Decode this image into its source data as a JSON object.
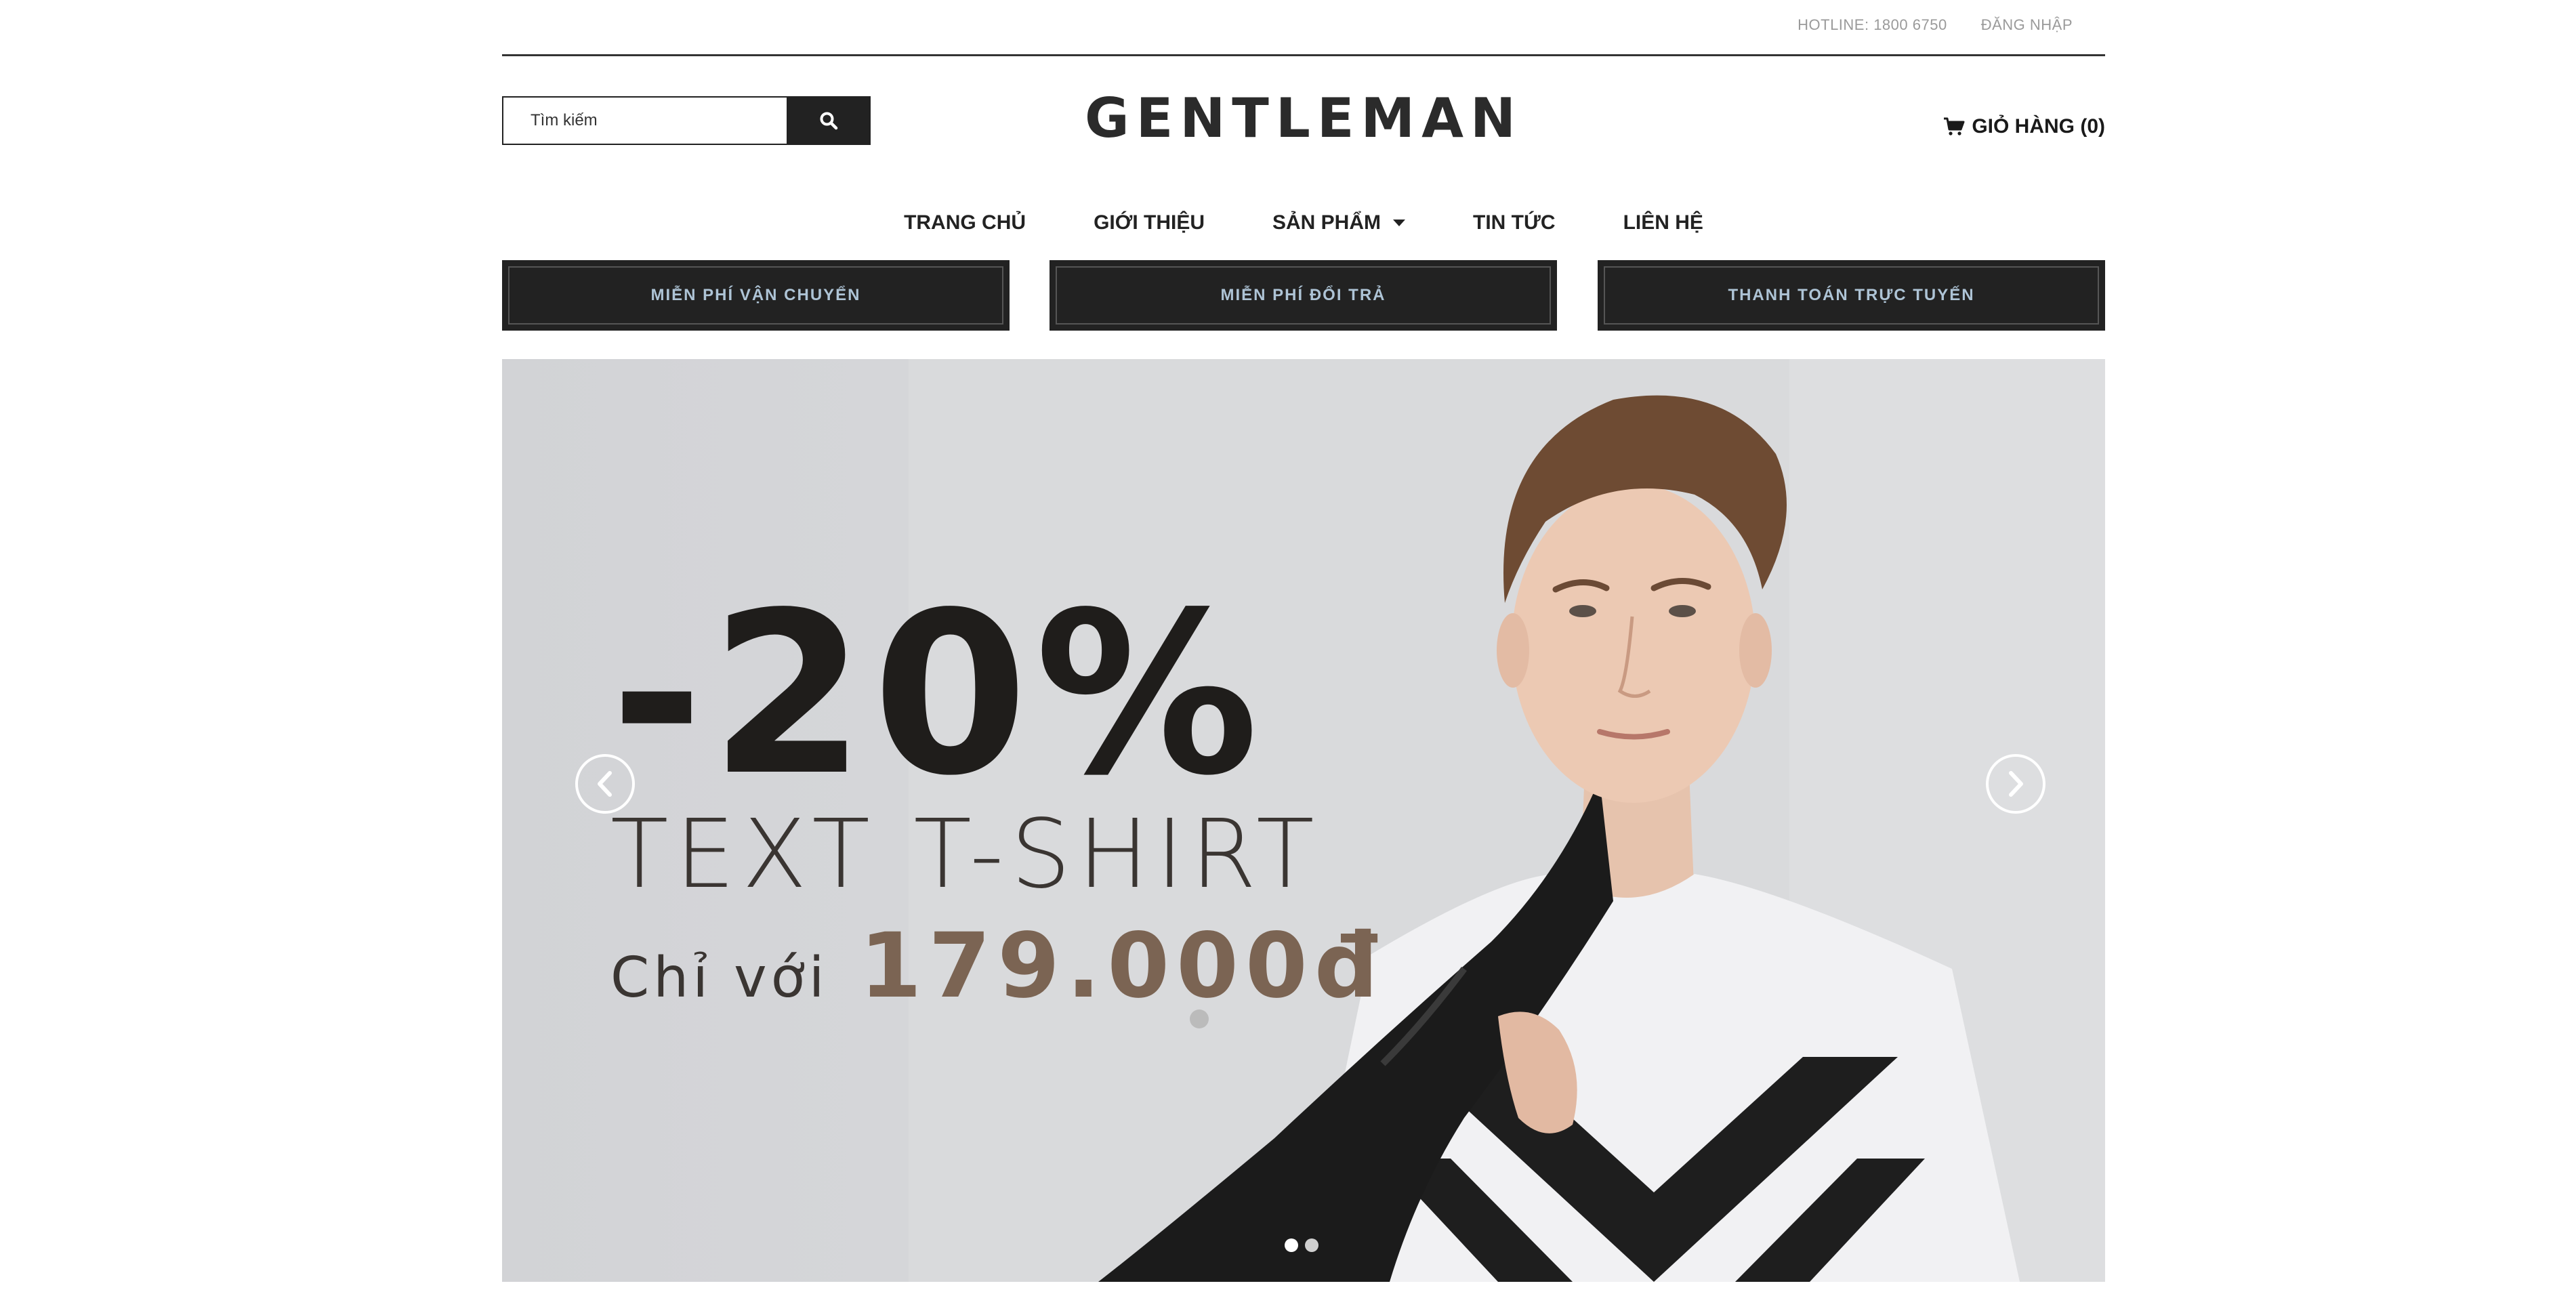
{
  "topbar": {
    "hotline": "HOTLINE: 1800 6750",
    "login": "ĐĂNG NHẬP"
  },
  "search": {
    "placeholder": "Tìm kiếm",
    "icon": "search-icon"
  },
  "logo": "GENTLEMAN",
  "cart": {
    "label": "GIỎ HÀNG (0)",
    "icon": "cart-icon"
  },
  "nav": {
    "items": [
      {
        "label": "TRANG CHỦ"
      },
      {
        "label": "GIỚI THIỆU"
      },
      {
        "label": "SẢN PHẨM"
      },
      {
        "label": "TIN TỨC"
      },
      {
        "label": "LIÊN HỆ"
      }
    ]
  },
  "features": [
    {
      "label": "MIỄN PHÍ VẬN CHUYỂN"
    },
    {
      "label": "MIỄN PHÍ ĐỔI TRẢ"
    },
    {
      "label": "THANH TOÁN TRỰC TUYẾN"
    }
  ],
  "slider": {
    "discount": "-20%",
    "product": "TEXT T-SHIRT",
    "only": "Chỉ với",
    "price": "179.000đ",
    "slide_count": 2,
    "active_slide": 1
  },
  "colors": {
    "dark": "#222222",
    "feature_text": "#aec4d6",
    "price": "#7b6453",
    "slider_bg": "#d6d7da"
  }
}
